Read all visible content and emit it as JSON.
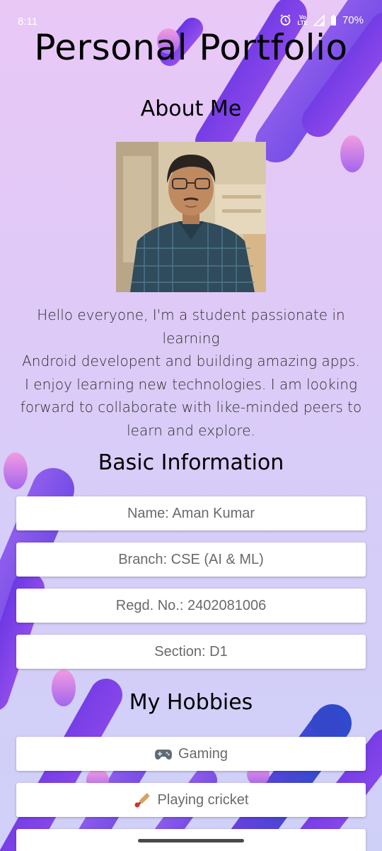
{
  "status_bar": {
    "time": "8:11",
    "battery": "70%",
    "network_label_top": "Vo",
    "network_label_bottom": "LTE"
  },
  "app": {
    "title": "Personal Portfolio"
  },
  "about": {
    "heading": "About Me",
    "text_lines": [
      "Hello everyone, I'm a student passionate in learning",
      "Android developent and building amazing apps.",
      "I enjoy learning new technologies. I am looking",
      "forward to collaborate with like-minded peers to",
      "learn and explore."
    ]
  },
  "basic_info": {
    "heading": "Basic Information",
    "items": [
      "Name: Aman Kumar",
      "Branch: CSE (AI & ML)",
      "Regd. No.: 2402081006",
      "Section: D1"
    ]
  },
  "hobbies": {
    "heading": "My Hobbies",
    "items": [
      {
        "icon": "game-controller-icon",
        "label": "Gaming"
      },
      {
        "icon": "cricket-bat-icon",
        "label": "Playing cricket"
      }
    ]
  },
  "colors": {
    "accent_purple": "#7b3fe4",
    "accent_violet": "#a55cf0",
    "bubble_pink": "#e77fd6",
    "text_dark": "#000000",
    "card_text": "#6a6a6a"
  }
}
